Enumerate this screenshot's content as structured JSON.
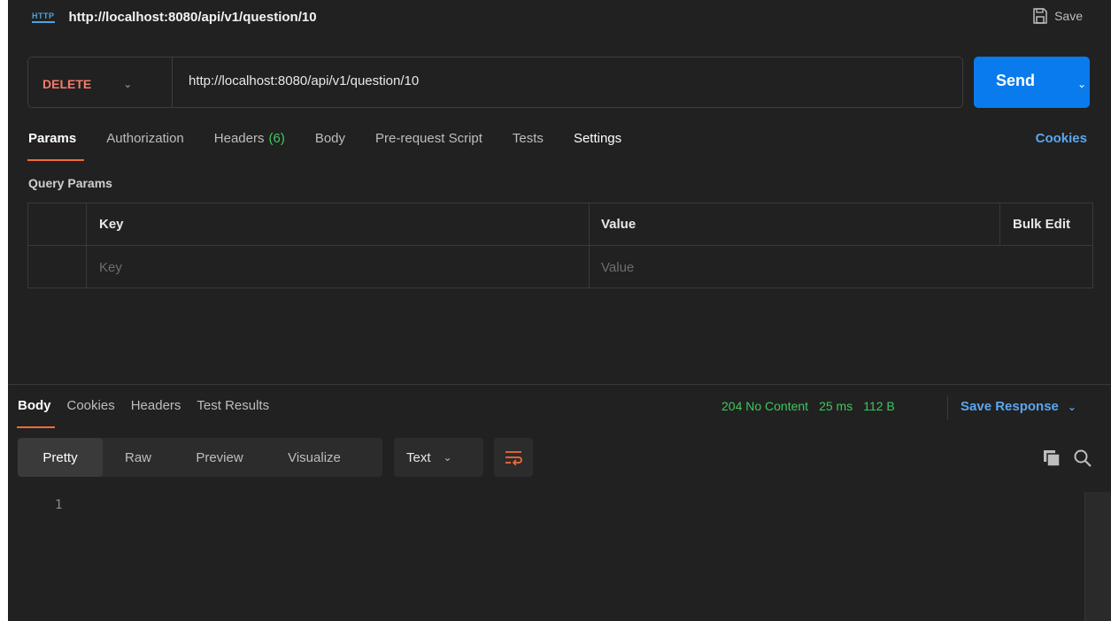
{
  "header": {
    "http_badge": "HTTP",
    "title": "http://localhost:8080/api/v1/question/10",
    "save_label": "Save"
  },
  "request": {
    "method": "DELETE",
    "url": "http://localhost:8080/api/v1/question/10",
    "send_label": "Send"
  },
  "request_tabs": {
    "params": "Params",
    "authorization": "Authorization",
    "headers": "Headers",
    "headers_count": "(6)",
    "body": "Body",
    "prerequest": "Pre-request Script",
    "tests": "Tests",
    "settings": "Settings",
    "cookies": "Cookies"
  },
  "params": {
    "section_label": "Query Params",
    "col_key": "Key",
    "col_value": "Value",
    "bulk_edit": "Bulk Edit",
    "key_placeholder": "Key",
    "value_placeholder": "Value"
  },
  "response": {
    "tabs": {
      "body": "Body",
      "cookies": "Cookies",
      "headers": "Headers",
      "test_results": "Test Results"
    },
    "status": "204 No Content",
    "time": "25 ms",
    "size": "112 B",
    "save_response": "Save Response",
    "view_modes": {
      "pretty": "Pretty",
      "raw": "Raw",
      "preview": "Preview",
      "visualize": "Visualize"
    },
    "format": "Text",
    "line_numbers": [
      "1"
    ]
  },
  "colors": {
    "accent": "#f26b3a",
    "send": "#097bed",
    "method_delete": "#f27b6d",
    "status_ok": "#3cc95c",
    "link": "#5aa6f0"
  },
  "icons": {
    "save": "floppy-icon",
    "copy": "copy-icon",
    "search": "search-icon",
    "wrap": "wrap-lines-icon"
  }
}
